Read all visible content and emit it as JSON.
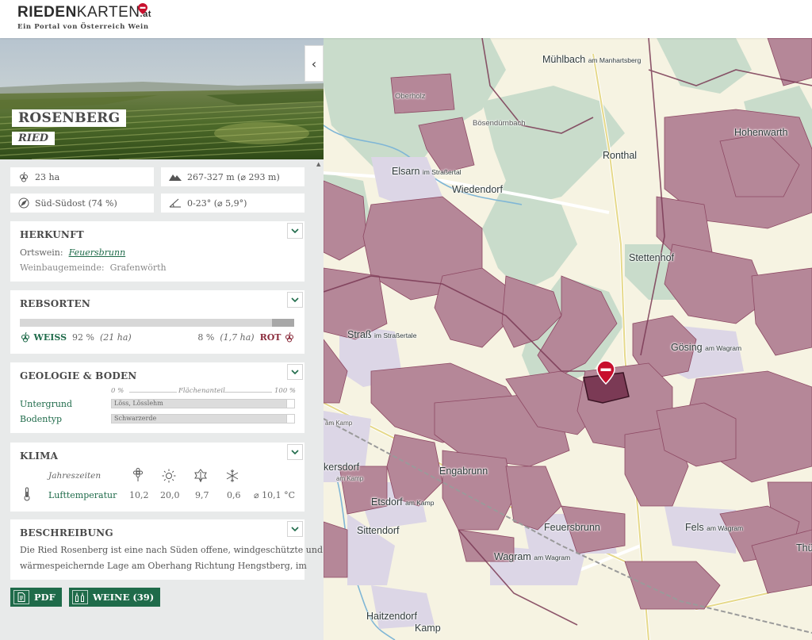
{
  "logo": {
    "part1": "RIEDEN",
    "part2": "KARTEN",
    "tld": ".at",
    "tagline": "Ein Portal von Österreich Wein"
  },
  "hero": {
    "title": "ROSENBERG",
    "subtitle": "RIED"
  },
  "collapse_icon": "‹",
  "stats": {
    "area": "23 ha",
    "altitude": "267-327 m (⌀ 293 m)",
    "exposure": "Süd-Südost (74 %)",
    "slope": "0-23° (⌀ 5,9°)"
  },
  "herkunft": {
    "heading": "HERKUNFT",
    "ortswein_label": "Ortswein:",
    "ortswein_value": "Feuersbrunn",
    "gemeinde_label": "Weinbaugemeinde:",
    "gemeinde_value": "Grafenwörth"
  },
  "rebsorten": {
    "heading": "REBSORTEN",
    "weiss_label": "WEISS",
    "weiss_value": "92 %",
    "weiss_ha": "(21 ha)",
    "rot_value": "8 %",
    "rot_ha": "(1,7 ha)",
    "rot_label": "ROT",
    "weiss_fraction": 0.92,
    "bar_color_weiss": "#d7d7d7",
    "bar_color_rot": "#a8a8a8"
  },
  "geologie": {
    "heading": "GEOLOGIE & BODEN",
    "scale_left": "0 %",
    "scale_mid": "Flächenanteil",
    "scale_right": "100 %",
    "untergrund_label": "Untergrund",
    "untergrund_value": "Löss, Lösslehm",
    "bodentyp_label": "Bodentyp",
    "bodentyp_value": "Schwarzerde"
  },
  "klima": {
    "heading": "KLIMA",
    "seasons_label": "Jahreszeiten",
    "temp_label": "Lufttemperatur",
    "values": [
      "10,2",
      "20,0",
      "9,7",
      "0,6"
    ],
    "average": "⌀ 10,1 °C",
    "season_icons": [
      "spring-flower-icon",
      "summer-sun-icon",
      "autumn-leaf-icon",
      "winter-snowflake-icon"
    ]
  },
  "beschreibung": {
    "heading": "BESCHREIBUNG",
    "line1": "Die Ried Rosenberg ist eine nach Süden offene, windgeschützte und",
    "line2": "wärmespeichernde Lage am Oberhang Richtung Hengstberg, im"
  },
  "buttons": {
    "pdf": "PDF",
    "weine": "WEINE (39)"
  },
  "map_labels": {
    "muehlbach": "Mühlbach",
    "muehlbach_sub": "am Manhartsberg",
    "oberholz": "Oberholz",
    "boesenduernbach": "Bösendürnbach",
    "hohenwarth": "Hohenwarth",
    "ronthal": "Ronthal",
    "elsarn": "Elsarn",
    "elsarn_sub": "im Straßertal",
    "wiedendorf": "Wiedendorf",
    "stettenhof": "Stettenhof",
    "strass": "Straß",
    "strass_sub": "im Straßertale",
    "goesing": "Gösing",
    "goesing_sub": "am Wagram",
    "kersdorf": "kersdorf",
    "kersdorf_sub": "am Kamp",
    "engabrunn": "Engabrunn",
    "etsdorf": "Etsdorf",
    "etsdorf_sub": "am Kamp",
    "sittendorf": "Sittendorf",
    "feuersbrunn": "Feuersbrunn",
    "fels": "Fels",
    "fels_sub": "am Wagram",
    "wagram": "Wagram",
    "wagram_sub": "am Wagram",
    "haitzendorf": "Haitzendorf",
    "kamp": "Kamp",
    "thue": "Thü",
    "am_kamp": "am Kamp"
  },
  "colors": {
    "accent": "#1f6b4a",
    "vineyard": "#a0607a",
    "vineyard_fill": "#b58798",
    "forest": "#c9dccb",
    "map_bg": "#f6f3e2",
    "rot": "#8b2c3c"
  }
}
